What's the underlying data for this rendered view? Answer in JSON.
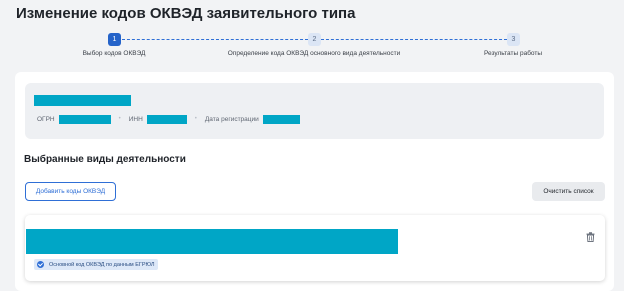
{
  "page": {
    "title": "Изменение кодов ОКВЭД заявительного типа"
  },
  "stepper": {
    "steps": [
      {
        "number": "1",
        "label": "Выбор кодов ОКВЭД",
        "state": "active"
      },
      {
        "number": "2",
        "label": "Определение кода ОКВЭД основного вида деятельности",
        "state": "inactive"
      },
      {
        "number": "3",
        "label": "Результаты работы",
        "state": "inactive"
      }
    ]
  },
  "organization": {
    "ogrn_label": "ОГРН",
    "inn_label": "ИНН",
    "registration_date_label": "Дата регистрации"
  },
  "activities": {
    "section_title": "Выбранные виды деятельности",
    "add_button": "Добавить коды ОКВЭД",
    "clear_button": "Очистить список",
    "items": [
      {
        "main_code_badge": "Основной код ОКВЭД по данным ЕГРЮЛ"
      }
    ]
  },
  "colors": {
    "accent": "#2f6fd6",
    "redaction": "#00a6c6",
    "badge_bg": "#dde8f8"
  },
  "icons": {
    "delete": "trash-icon",
    "badge": "check-icon"
  }
}
